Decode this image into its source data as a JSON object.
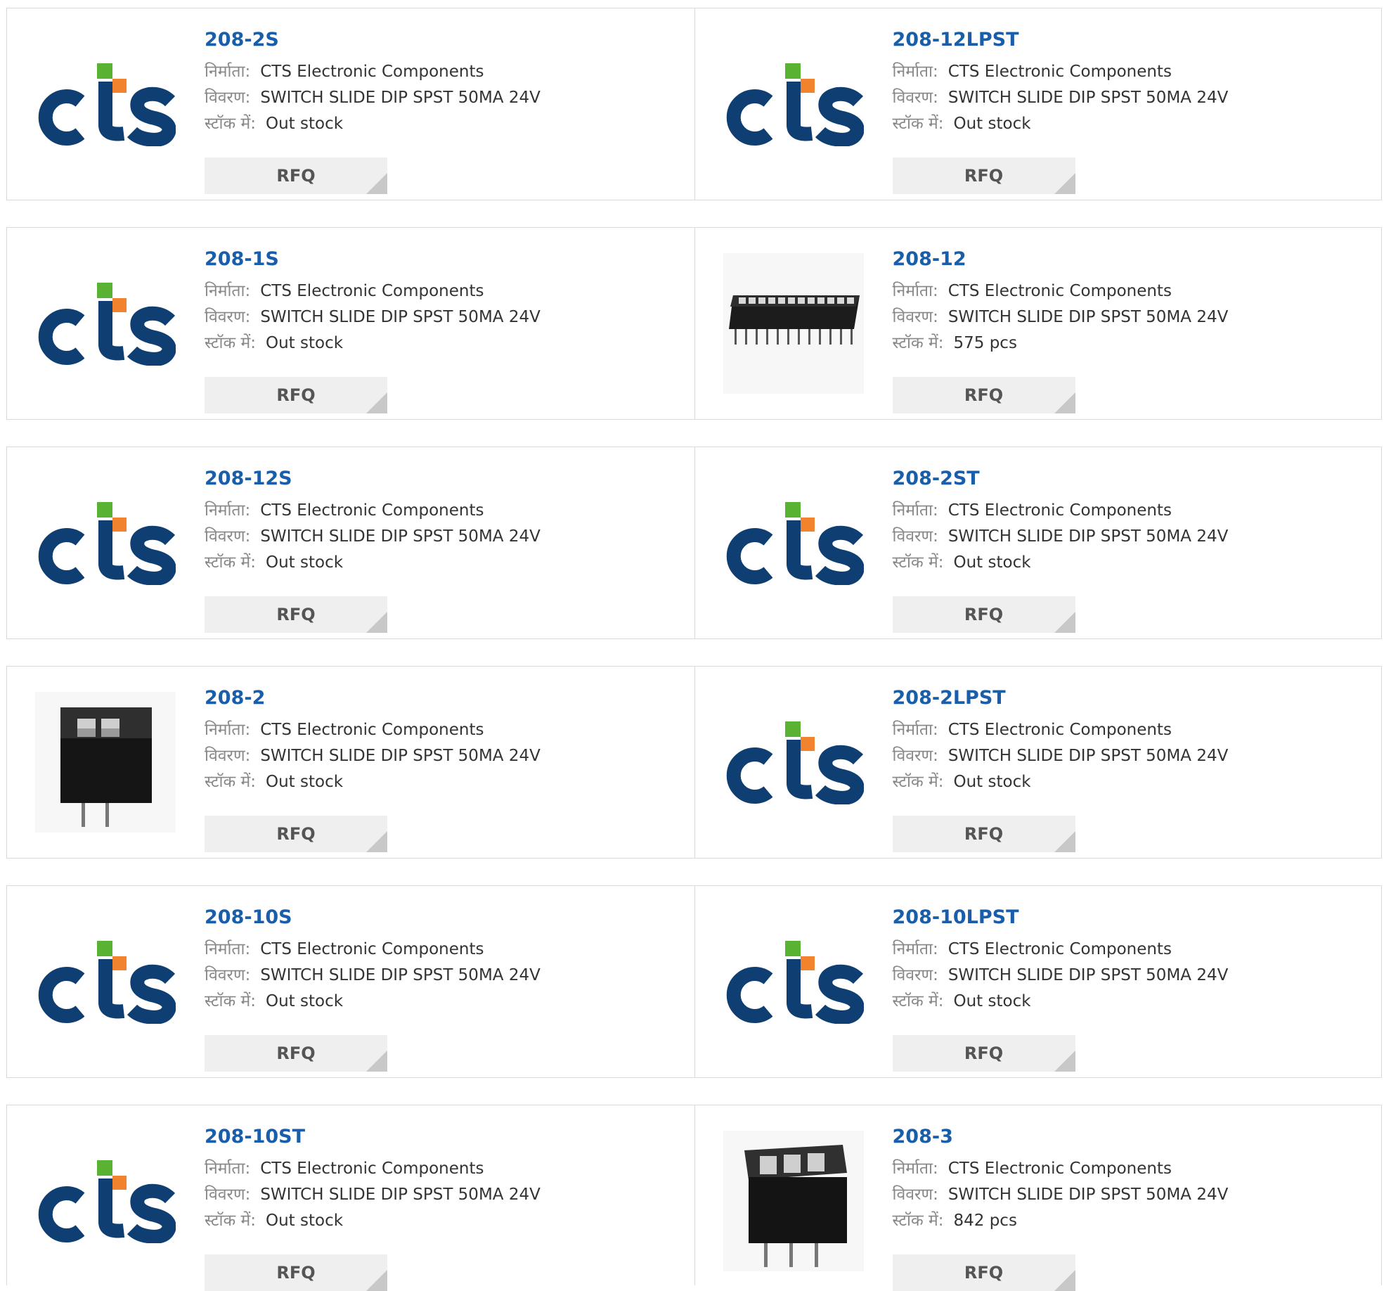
{
  "labels": {
    "manufacturer": "निर्माता:",
    "description": "विवरण:",
    "stock": "स्टॉक में:",
    "rfq": "RFQ"
  },
  "colors": {
    "cts_blue": "#0f3f72",
    "cts_green": "#5ab233",
    "cts_orange": "#f1832f",
    "link_blue": "#1a5eaa",
    "rfq_bg": "#efefef"
  },
  "rows": [
    [
      {
        "part": "208-2S",
        "image": "cts-logo",
        "manufacturer": "CTS Electronic Components",
        "description": "SWITCH SLIDE DIP SPST 50MA 24V",
        "stock": "Out stock"
      },
      {
        "part": "208-12LPST",
        "image": "cts-logo",
        "manufacturer": "CTS Electronic Components",
        "description": "SWITCH SLIDE DIP SPST 50MA 24V",
        "stock": "Out stock"
      }
    ],
    [
      {
        "part": "208-1S",
        "image": "cts-logo",
        "manufacturer": "CTS Electronic Components",
        "description": "SWITCH SLIDE DIP SPST 50MA 24V",
        "stock": "Out stock"
      },
      {
        "part": "208-12",
        "image": "dip-12-photo",
        "manufacturer": "CTS Electronic Components",
        "description": "SWITCH SLIDE DIP SPST 50MA 24V",
        "stock": "575 pcs"
      }
    ],
    [
      {
        "part": "208-12S",
        "image": "cts-logo",
        "manufacturer": "CTS Electronic Components",
        "description": "SWITCH SLIDE DIP SPST 50MA 24V",
        "stock": "Out stock"
      },
      {
        "part": "208-2ST",
        "image": "cts-logo",
        "manufacturer": "CTS Electronic Components",
        "description": "SWITCH SLIDE DIP SPST 50MA 24V",
        "stock": "Out stock"
      }
    ],
    [
      {
        "part": "208-2",
        "image": "dip-2-photo",
        "manufacturer": "CTS Electronic Components",
        "description": "SWITCH SLIDE DIP SPST 50MA 24V",
        "stock": "Out stock"
      },
      {
        "part": "208-2LPST",
        "image": "cts-logo",
        "manufacturer": "CTS Electronic Components",
        "description": "SWITCH SLIDE DIP SPST 50MA 24V",
        "stock": "Out stock"
      }
    ],
    [
      {
        "part": "208-10S",
        "image": "cts-logo",
        "manufacturer": "CTS Electronic Components",
        "description": "SWITCH SLIDE DIP SPST 50MA 24V",
        "stock": "Out stock"
      },
      {
        "part": "208-10LPST",
        "image": "cts-logo",
        "manufacturer": "CTS Electronic Components",
        "description": "SWITCH SLIDE DIP SPST 50MA 24V",
        "stock": "Out stock"
      }
    ],
    [
      {
        "part": "208-10ST",
        "image": "cts-logo",
        "manufacturer": "CTS Electronic Components",
        "description": "SWITCH SLIDE DIP SPST 50MA 24V",
        "stock": "Out stock"
      },
      {
        "part": "208-3",
        "image": "dip-3-photo",
        "manufacturer": "CTS Electronic Components",
        "description": "SWITCH SLIDE DIP SPST 50MA 24V",
        "stock": "842 pcs"
      }
    ]
  ]
}
